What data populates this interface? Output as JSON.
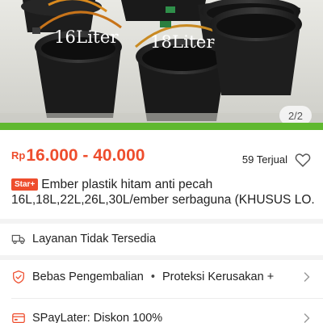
{
  "hero": {
    "label_small": "16Liter",
    "label_large": "18Liter",
    "image_counter": "2/2"
  },
  "price": {
    "currency": "Rp",
    "range": "16.000 - 40.000"
  },
  "sold": "59 Terjual",
  "title": {
    "badge": "Star+",
    "line1": "Ember plastik hitam anti pecah",
    "line2": "16L,18L,22L,26L,30L/ember serbaguna (KHUSUS LO..."
  },
  "rows": {
    "shipping": "Layanan Tidak Tersedia",
    "returns": "Bebas Pengembalian",
    "protection": "Proteksi Kerusakan +",
    "separator": "•",
    "paylater": "SPayLater: Diskon 100%"
  },
  "colors": {
    "accent": "#ee4d2d",
    "strip": "#5fb82f"
  },
  "icons": [
    "heart-icon",
    "truck-icon",
    "shield-check-icon",
    "paylater-icon",
    "chevron-right-icon"
  ]
}
